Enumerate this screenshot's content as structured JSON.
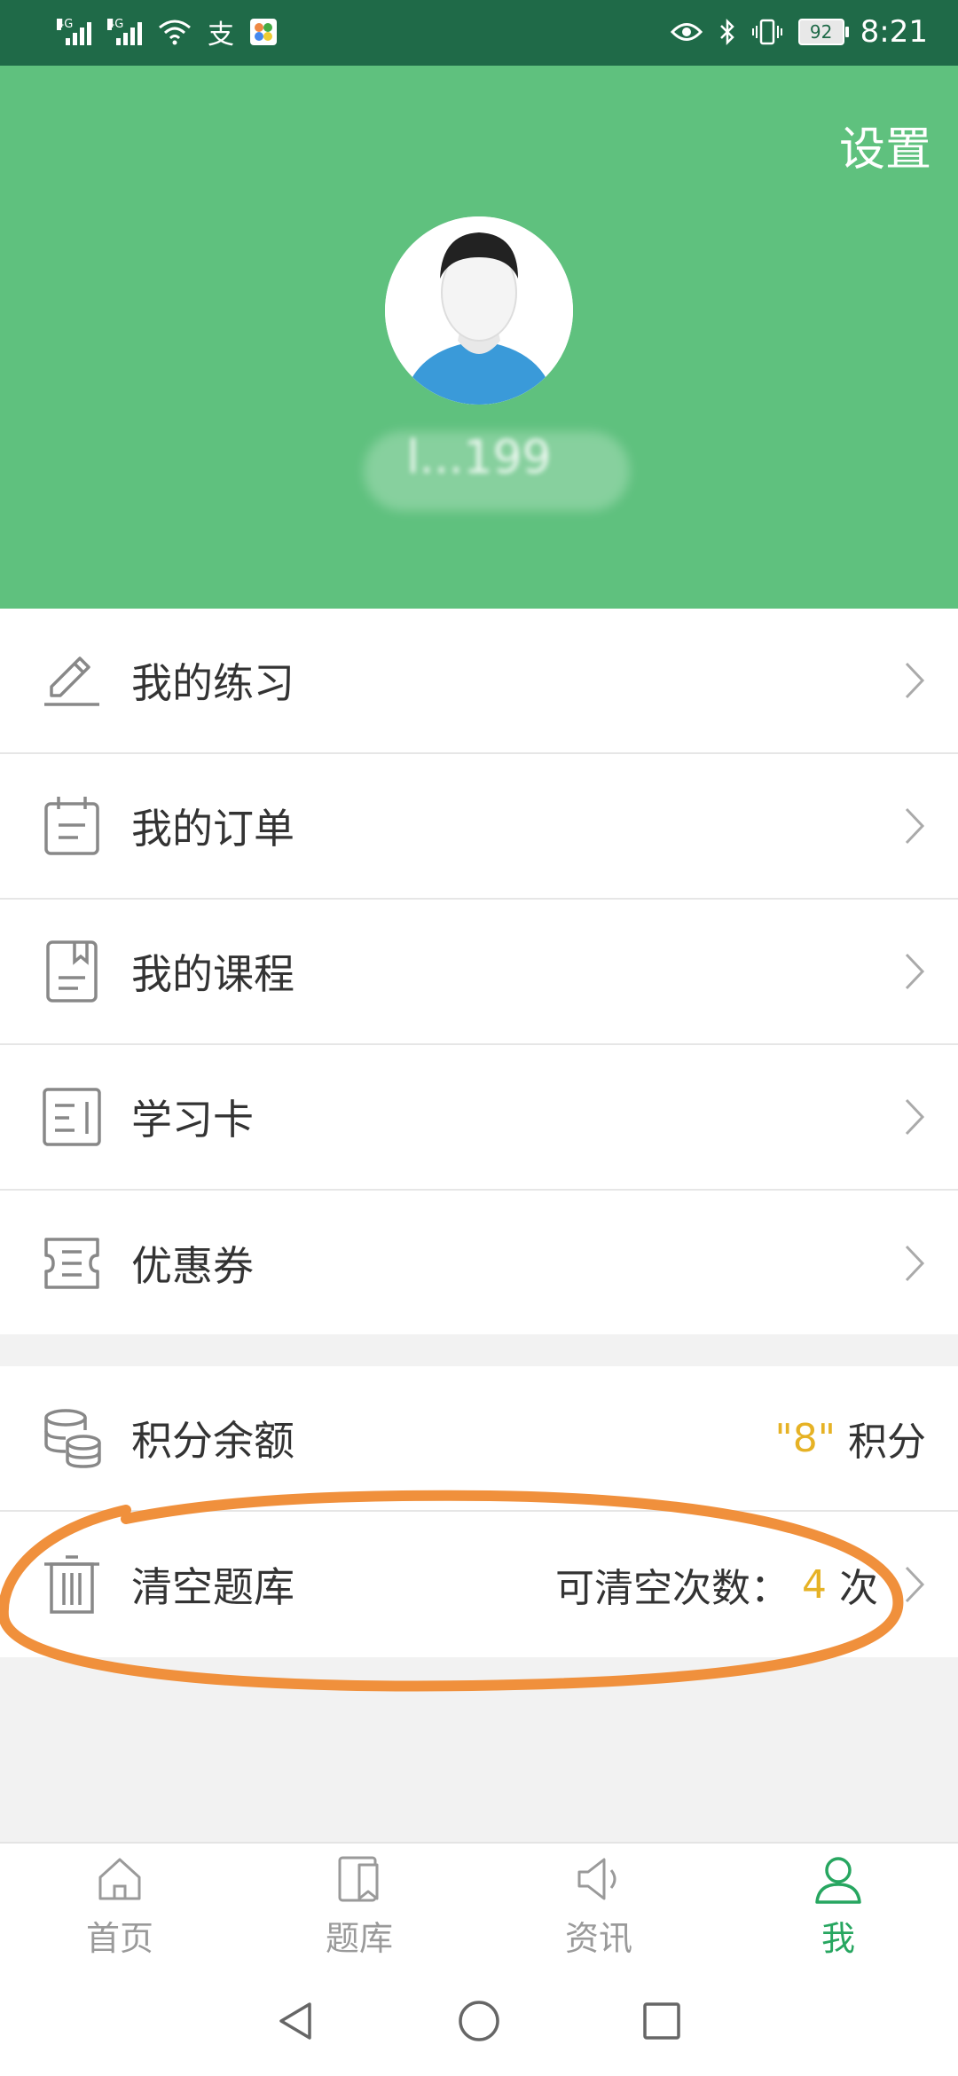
{
  "status_bar": {
    "network1": "4G",
    "network2": "4G",
    "battery": "92",
    "time": "8:21"
  },
  "header": {
    "settings_label": "设置",
    "username": "l...199"
  },
  "menu": {
    "items": [
      {
        "label": "我的练习",
        "icon": "pencil-icon"
      },
      {
        "label": "我的订单",
        "icon": "calendar-icon"
      },
      {
        "label": "我的课程",
        "icon": "book-icon"
      },
      {
        "label": "学习卡",
        "icon": "card-icon"
      },
      {
        "label": "优惠券",
        "icon": "coupon-icon"
      }
    ],
    "points": {
      "label": "积分余额",
      "value_quoted": "\"8\"",
      "unit": "积分",
      "icon": "coins-icon"
    },
    "clear": {
      "label": "清空题库",
      "prefix": "可清空次数：",
      "count": "4",
      "suffix": "次",
      "icon": "trash-icon"
    }
  },
  "bottom_nav": {
    "tabs": [
      {
        "label": "首页",
        "icon": "home-icon",
        "active": false
      },
      {
        "label": "题库",
        "icon": "bookmark-icon",
        "active": false
      },
      {
        "label": "资讯",
        "icon": "speaker-icon",
        "active": false
      },
      {
        "label": "我",
        "icon": "person-icon",
        "active": true
      }
    ]
  },
  "colors": {
    "header_green": "#5fc17e",
    "status_green": "#1f6a48",
    "accent_green": "#27a660",
    "gold": "#e6b225",
    "annotation_orange": "#f0903c"
  }
}
